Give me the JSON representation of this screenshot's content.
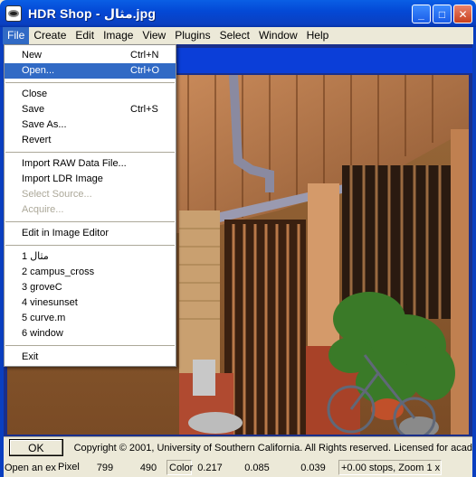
{
  "window": {
    "title": "HDR Shop - مثال.jpg",
    "buttons": {
      "minimize": "_",
      "maximize": "□",
      "close": "✕"
    }
  },
  "menubar": [
    "File",
    "Create",
    "Edit",
    "Image",
    "View",
    "Plugins",
    "Select",
    "Window",
    "Help"
  ],
  "file_menu": {
    "group1": [
      {
        "label": "New",
        "shortcut": "Ctrl+N"
      },
      {
        "label": "Open...",
        "shortcut": "Ctrl+O"
      }
    ],
    "group2": [
      {
        "label": "Close",
        "shortcut": ""
      },
      {
        "label": "Save",
        "shortcut": "Ctrl+S"
      },
      {
        "label": "Save As...",
        "shortcut": ""
      },
      {
        "label": "Revert",
        "shortcut": ""
      }
    ],
    "group3": [
      {
        "label": "Import RAW Data File..."
      },
      {
        "label": "Import LDR Image"
      },
      {
        "label": "Select Source..."
      },
      {
        "label": "Acquire..."
      }
    ],
    "group4": [
      {
        "label": "Edit in Image Editor"
      }
    ],
    "recent": [
      "1 مثال",
      "2 campus_cross",
      "3 groveC",
      "4 vinesunset",
      "5 curve.m",
      "6 window"
    ],
    "exit": "Exit"
  },
  "status": {
    "ok": "OK",
    "copyright": "Copyright © 2001, University of Southern California.  All Rights reserved.  Licensed for acad",
    "hint": "Open an ex",
    "pixel_label": "Pixel",
    "pixel_x": "799",
    "pixel_y": "490",
    "color_label": "Color",
    "r": "0.217",
    "g": "0.085",
    "b": "0.039",
    "zoom": "+0.00 stops, Zoom 1 x"
  },
  "colors": {
    "title_blue": "#0449d6",
    "highlight": "#316ac5",
    "face": "#ece9d8"
  }
}
